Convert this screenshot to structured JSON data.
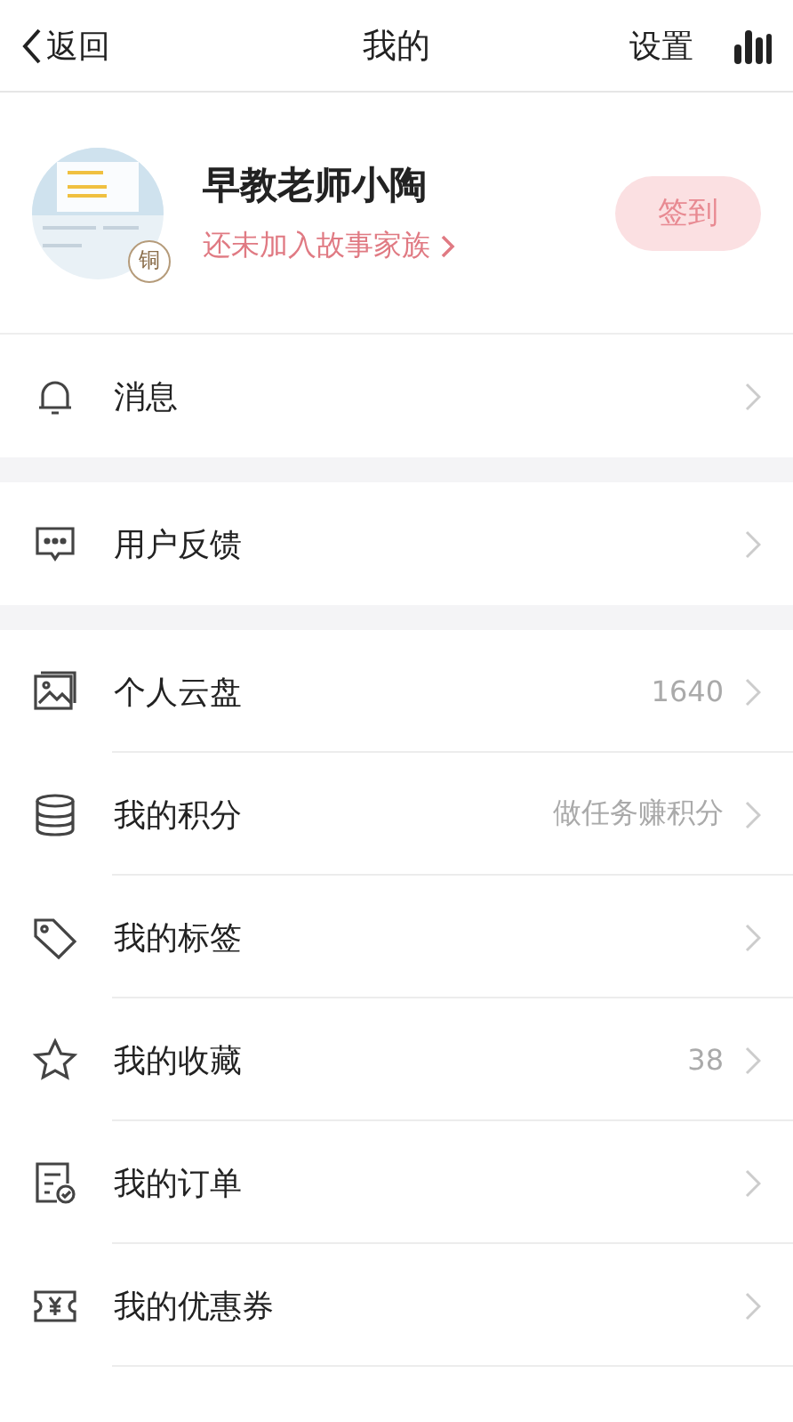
{
  "header": {
    "back": "返回",
    "title": "我的",
    "settings": "设置"
  },
  "profile": {
    "name": "早教老师小陶",
    "badge": "铜",
    "family_link": "还未加入故事家族",
    "checkin": "签到"
  },
  "groups": [
    {
      "items": [
        {
          "label": "消息"
        }
      ]
    },
    {
      "items": [
        {
          "label": "用户反馈"
        }
      ]
    },
    {
      "items": [
        {
          "label": "个人云盘",
          "value": "1640"
        },
        {
          "label": "我的积分",
          "value": "做任务赚积分"
        },
        {
          "label": "我的标签"
        },
        {
          "label": "我的收藏",
          "value": "38"
        },
        {
          "label": "我的订单"
        },
        {
          "label": "我的优惠券"
        }
      ]
    }
  ]
}
